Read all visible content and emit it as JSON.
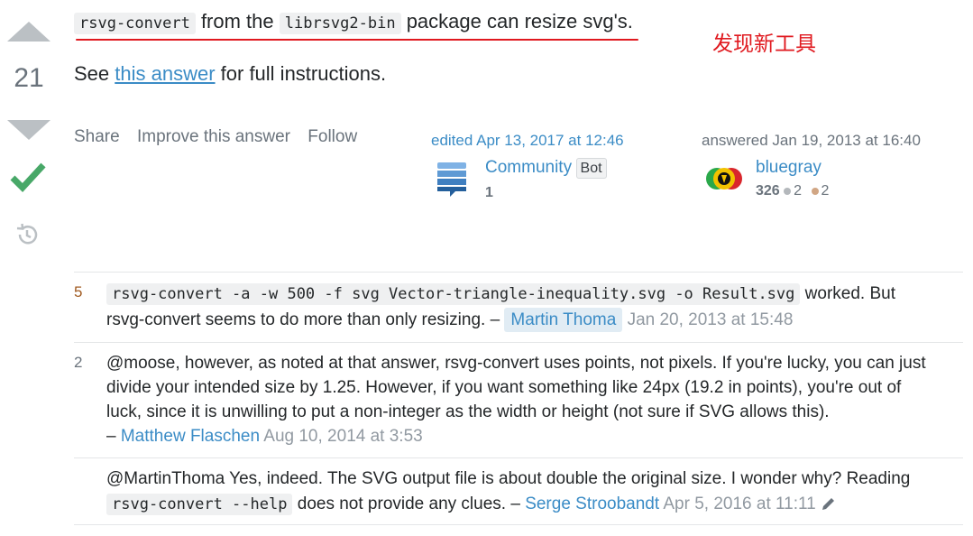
{
  "vote": {
    "count": "21"
  },
  "answer": {
    "cmd1": "rsvg-convert",
    "mid1": " from the ",
    "cmd2": "librsvg2-bin",
    "tail1": " package can resize svg's.",
    "line2_pre": "See ",
    "line2_link": "this answer",
    "line2_post": " for full instructions."
  },
  "annotation": "发现新工具",
  "menu": {
    "share": "Share",
    "improve": "Improve this answer",
    "follow": "Follow"
  },
  "edited": {
    "action": "edited Apr 13, 2017 at 12:46",
    "user": "Community",
    "bot": "Bot",
    "rep": "1"
  },
  "answered": {
    "action": "answered Jan 19, 2013 at 16:40",
    "user": "bluegray",
    "rep": "326",
    "silver": "2",
    "bronze": "2"
  },
  "comments": [
    {
      "score": "5",
      "code": "rsvg-convert -a -w 500 -f svg Vector-triangle-inequality.svg -o Result.svg",
      "text_after_code": " worked. But",
      "text_line2": "rsvg-convert seems to do more than only resizing. – ",
      "user": "Martin Thoma",
      "date": "Jan 20, 2013 at 15:48"
    },
    {
      "score": "2",
      "line1": "@moose, however, as noted at that answer, rsvg-convert uses points, not pixels. If you're lucky, you can just",
      "line2": "divide your intended size by 1.25. However, if you want something like 24px (19.2 in points), you're out of",
      "line3": "luck, since it is unwilling to put a non-integer as the width or height (not sure if SVG allows this).",
      "dash": "– ",
      "user": "Matthew Flaschen",
      "date": "Aug 10, 2014 at 3:53"
    },
    {
      "score": "",
      "line1": "@MartinThoma Yes, indeed. The SVG output file is about double the original size. I wonder why? Reading",
      "code": "rsvg-convert --help",
      "text_after_code": " does not provide any clues. – ",
      "user": "Serge Stroobandt",
      "date": "Apr 5, 2016 at 11:11"
    }
  ],
  "colors": {
    "link": "#3b8cc6",
    "accept": "#48a868",
    "annotation_red": "#e0191f",
    "muted": "#6a737c"
  },
  "icons": [
    "upvote-arrow-icon",
    "downvote-arrow-icon",
    "accepted-check-icon",
    "history-icon",
    "community-avatar-icon",
    "bluegray-avatar-icon",
    "pencil-icon"
  ]
}
